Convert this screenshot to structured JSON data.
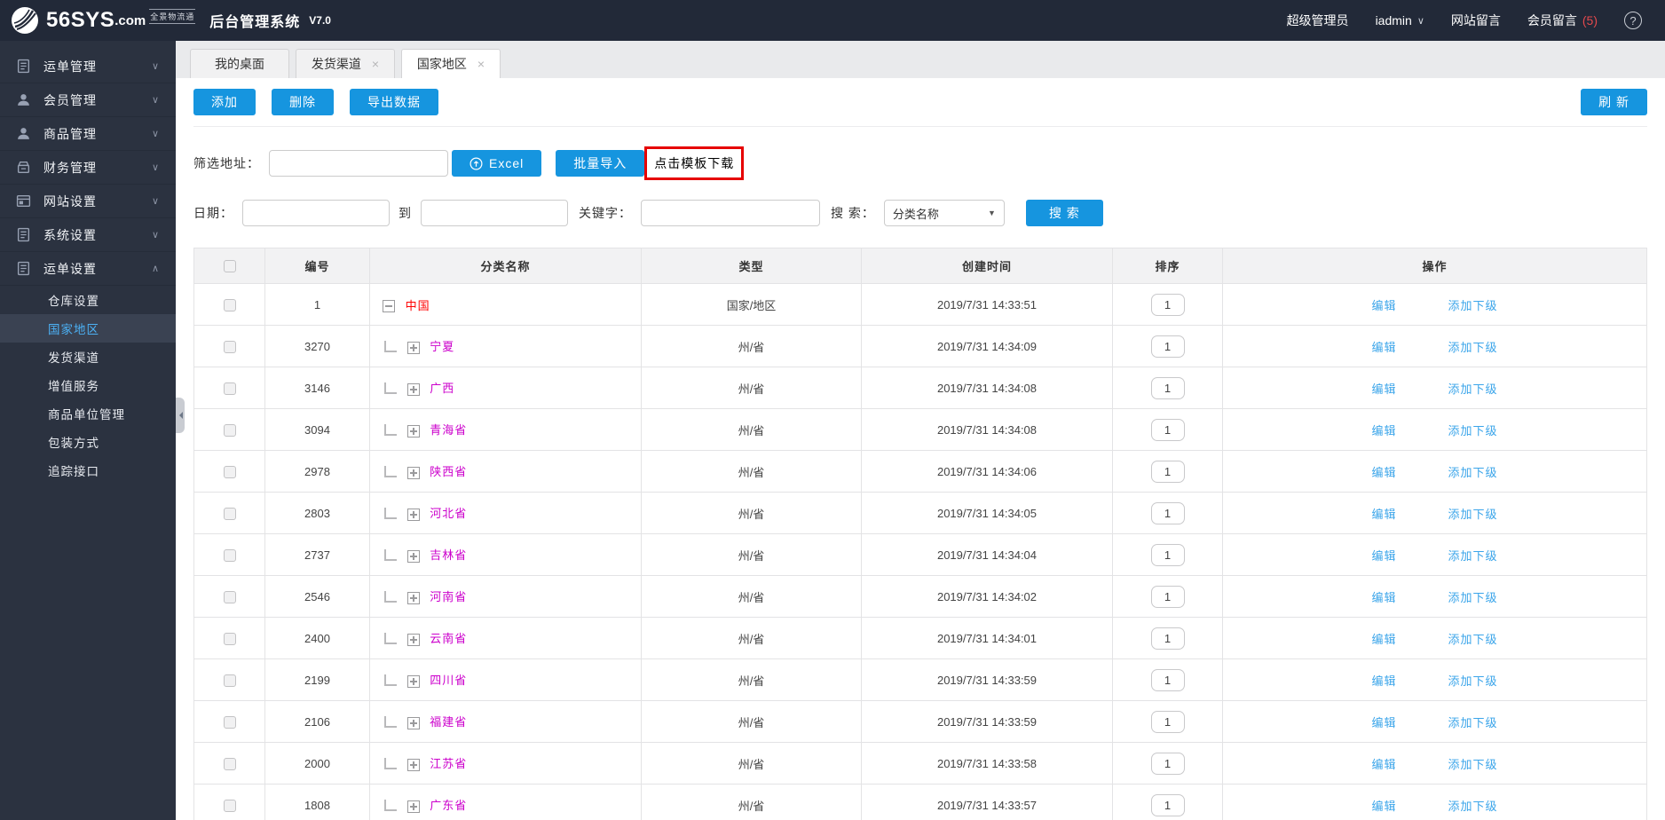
{
  "topbar": {
    "logo_text": "56SYS",
    "logo_tld": ".com",
    "logo_sub": "全景物流通",
    "app_title": "后台管理系统",
    "version": "V7.0",
    "role": "超级管理员",
    "username": "iadmin",
    "site_msg": "网站留言",
    "member_msg": "会员留言",
    "member_msg_count": "(5)"
  },
  "icons": {
    "chevron_down": "∨",
    "chevron_up": "∧",
    "close": "×",
    "help": "?",
    "dropdown_arrow": "▼"
  },
  "sidebar": {
    "items": [
      {
        "label": "运单管理"
      },
      {
        "label": "会员管理"
      },
      {
        "label": "商品管理"
      },
      {
        "label": "财务管理"
      },
      {
        "label": "网站设置"
      },
      {
        "label": "系统设置"
      },
      {
        "label": "运单设置"
      }
    ],
    "sub_items": [
      {
        "label": "仓库设置"
      },
      {
        "label": "国家地区"
      },
      {
        "label": "发货渠道"
      },
      {
        "label": "增值服务"
      },
      {
        "label": "商品单位管理"
      },
      {
        "label": "包装方式"
      },
      {
        "label": "追踪接口"
      }
    ],
    "active_sub": "国家地区"
  },
  "tabs": [
    {
      "label": "我的桌面",
      "closable": false
    },
    {
      "label": "发货渠道",
      "closable": true
    },
    {
      "label": "国家地区",
      "closable": true,
      "active": true
    }
  ],
  "toolbar": {
    "add": "添加",
    "delete": "删除",
    "export": "导出数据",
    "refresh": "刷 新"
  },
  "filters": {
    "address_label": "筛选地址：",
    "address_value": "",
    "excel_label": "Excel",
    "batch_import": "批量导入",
    "template_download": "点击模板下载",
    "date_label": "日期：",
    "date_from_value": "",
    "to_label": "到",
    "date_to_value": "",
    "keyword_label": "关键字：",
    "keyword_value": "",
    "search_label": "搜 索：",
    "search_select": "分类名称",
    "search_button": "搜 索"
  },
  "table": {
    "headers": [
      "编号",
      "分类名称",
      "类型",
      "创建时间",
      "排序",
      "操作"
    ],
    "edit_label": "编辑",
    "add_child_label": "添加下级",
    "rows": [
      {
        "id": "1",
        "name": "中国",
        "type": "国家/地区",
        "created": "2019/7/31 14:33:51",
        "sort": "1",
        "level": "root"
      },
      {
        "id": "3270",
        "name": "宁夏",
        "type": "州/省",
        "created": "2019/7/31 14:34:09",
        "sort": "1",
        "level": "child"
      },
      {
        "id": "3146",
        "name": "广西",
        "type": "州/省",
        "created": "2019/7/31 14:34:08",
        "sort": "1",
        "level": "child"
      },
      {
        "id": "3094",
        "name": "青海省",
        "type": "州/省",
        "created": "2019/7/31 14:34:08",
        "sort": "1",
        "level": "child"
      },
      {
        "id": "2978",
        "name": "陕西省",
        "type": "州/省",
        "created": "2019/7/31 14:34:06",
        "sort": "1",
        "level": "child"
      },
      {
        "id": "2803",
        "name": "河北省",
        "type": "州/省",
        "created": "2019/7/31 14:34:05",
        "sort": "1",
        "level": "child"
      },
      {
        "id": "2737",
        "name": "吉林省",
        "type": "州/省",
        "created": "2019/7/31 14:34:04",
        "sort": "1",
        "level": "child"
      },
      {
        "id": "2546",
        "name": "河南省",
        "type": "州/省",
        "created": "2019/7/31 14:34:02",
        "sort": "1",
        "level": "child"
      },
      {
        "id": "2400",
        "name": "云南省",
        "type": "州/省",
        "created": "2019/7/31 14:34:01",
        "sort": "1",
        "level": "child"
      },
      {
        "id": "2199",
        "name": "四川省",
        "type": "州/省",
        "created": "2019/7/31 14:33:59",
        "sort": "1",
        "level": "child"
      },
      {
        "id": "2106",
        "name": "福建省",
        "type": "州/省",
        "created": "2019/7/31 14:33:59",
        "sort": "1",
        "level": "child"
      },
      {
        "id": "2000",
        "name": "江苏省",
        "type": "州/省",
        "created": "2019/7/31 14:33:58",
        "sort": "1",
        "level": "child"
      },
      {
        "id": "1808",
        "name": "广东省",
        "type": "州/省",
        "created": "2019/7/31 14:33:57",
        "sort": "1",
        "level": "child"
      }
    ]
  },
  "colors": {
    "accent_blue": "#1695df",
    "link_blue": "#3ba5ea",
    "root_region_red": "#ff0000",
    "province_magenta": "#cc00cc",
    "highlight_box_red": "#e60000",
    "message_count_red": "#e5494d",
    "topbar_bg": "#222938",
    "sidebar_bg": "#2b3240"
  }
}
